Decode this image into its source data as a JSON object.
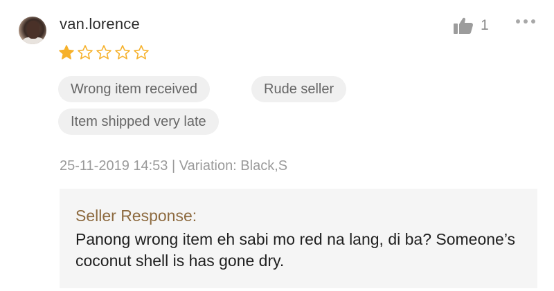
{
  "review": {
    "username": "van.lorence",
    "rating": 1,
    "max_rating": 5,
    "like_count": "1",
    "icons": {
      "avatar": "user-avatar",
      "like": "thumbs-up-icon",
      "more": "more-options-icon",
      "star_filled": "star-filled-icon",
      "star_empty": "star-outline-icon"
    },
    "tags": [
      "Wrong item received",
      "Rude seller",
      "Item shipped very late"
    ],
    "meta": "25-11-2019 14:53 | Variation: Black,S"
  },
  "seller_response": {
    "title": "Seller Response:",
    "text": "Panong wrong item eh sabi mo red na lang, di ba? Someone’s coconut shell is has gone dry."
  },
  "colors": {
    "star": "#f6b12b",
    "response_title": "#8d6a3f",
    "tag_bg": "#f0f0f0",
    "response_bg": "#f5f5f5"
  }
}
